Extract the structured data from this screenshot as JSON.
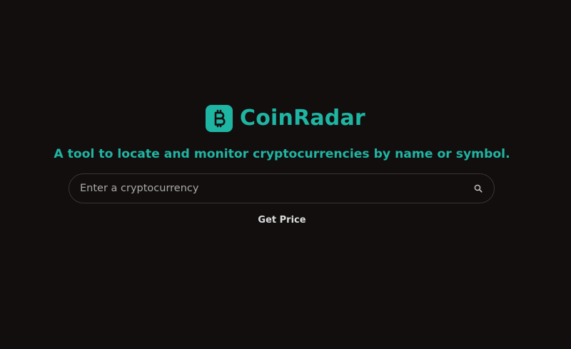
{
  "brand": {
    "name": "CoinRadar",
    "logo_icon": "bitcoin-icon",
    "accent_color": "#1fb5a3"
  },
  "tagline": "A tool to locate and monitor cryptocurrencies by name or symbol.",
  "search": {
    "value": "",
    "placeholder": "Enter a cryptocurrency",
    "icon": "search-icon"
  },
  "actions": {
    "get_price_label": "Get Price"
  },
  "colors": {
    "background": "#130e0e",
    "accent": "#1fb5a3",
    "input_border": "#3a3535"
  }
}
